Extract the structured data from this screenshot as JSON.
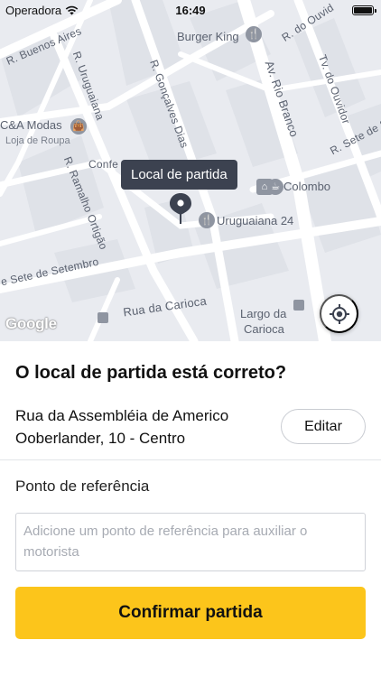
{
  "status_bar": {
    "carrier": "Operadora",
    "time": "16:49"
  },
  "map": {
    "streets": {
      "buenos_aires": "R. Buenos Aires",
      "uruguaiana": "R. Uruguaiana",
      "goncalves_dias": "R. Gonçalves Dias",
      "rio_branco": "Av. Rio Branco",
      "ouvidor_top": "R. do Ouvid",
      "ouvidor_tv": "Tv. do Ouvidor",
      "sete_setembro_right": "R. Sete de Se",
      "ramalho_ortigao": "R. Ramalho Ortigão",
      "sete_setembro_left": "e Sete de Setembro",
      "carioca": "Rua da Carioca",
      "confeitaria": "Confe"
    },
    "pois": {
      "burger_king": "Burger King",
      "ca_modas": "C&A Modas",
      "ca_modas_sub": "Loja de Roupa",
      "colombo": "Colombo",
      "uruguaiana24": "Uruguaiana 24",
      "largo_carioca_1": "Largo da",
      "largo_carioca_2": "Carioca"
    },
    "tooltip": "Local de partida",
    "attribution": "Google"
  },
  "sheet": {
    "title": "O local de partida está correto?",
    "address_line1": "Rua da Assembléia de Americo",
    "address_line2": "Ooberlander, 10 - Centro",
    "edit_label": "Editar",
    "reference_label": "Ponto de referência",
    "reference_placeholder": "Adicione um ponto de referência para auxiliar o motorista",
    "confirm_label": "Confirmar partida"
  },
  "colors": {
    "accent": "#fcc51b",
    "map_background": "#e9ebf0",
    "tooltip_background": "#3c4250"
  }
}
